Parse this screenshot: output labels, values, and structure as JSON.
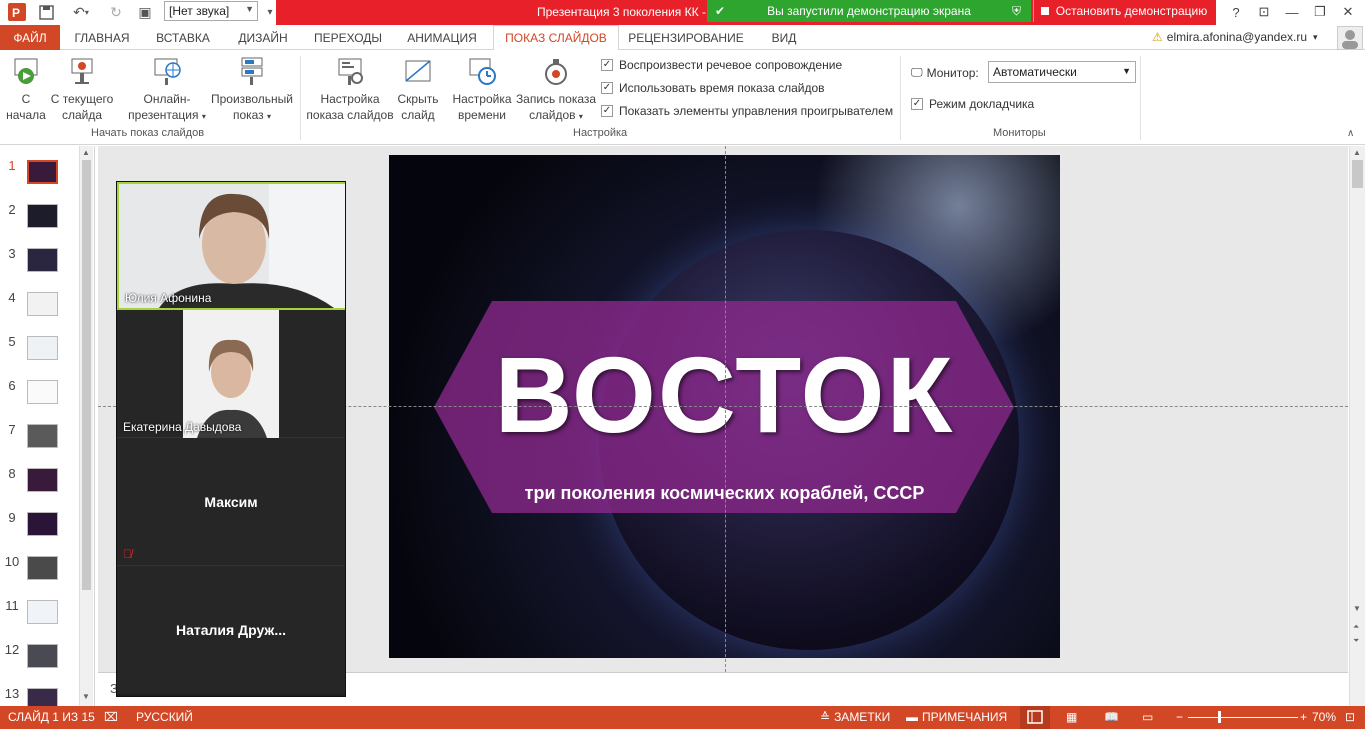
{
  "title_bar": {
    "sound_select_value": "[Нет звука]",
    "document_title": "Презентация 3 поколения КК -",
    "share_banner": "Вы запустили демонстрацию экрана",
    "stop_share_label": "Остановить демонстрацию",
    "help": "?"
  },
  "tabs": [
    {
      "label": "ФАЙЛ"
    },
    {
      "label": "ГЛАВНАЯ"
    },
    {
      "label": "ВСТАВКА"
    },
    {
      "label": "ДИЗАЙН"
    },
    {
      "label": "ПЕРЕХОДЫ"
    },
    {
      "label": "АНИМАЦИЯ"
    },
    {
      "label": "ПОКАЗ СЛАЙДОВ",
      "active": true
    },
    {
      "label": "РЕЦЕНЗИРОВАНИЕ"
    },
    {
      "label": "ВИД"
    }
  ],
  "account": {
    "email": "elmira.afonina@yandex.ru"
  },
  "ribbon": {
    "start_group": {
      "label": "Начать показ слайдов",
      "from_start": {
        "line1": "С",
        "line2": "начала"
      },
      "from_current": {
        "line1": "С текущего",
        "line2": "слайда"
      },
      "online": {
        "line1": "Онлайн-",
        "line2": "презентация"
      },
      "custom": {
        "line1": "Произвольный",
        "line2": "показ"
      }
    },
    "setup_group": {
      "label": "Настройка",
      "setup_show": {
        "line1": "Настройка",
        "line2": "показа слайдов"
      },
      "hide_slide": {
        "line1": "Скрыть",
        "line2": "слайд"
      },
      "rehearse": {
        "line1": "Настройка",
        "line2": "времени"
      },
      "record": {
        "line1": "Запись показа",
        "line2": "слайдов"
      },
      "checks": [
        "Воспроизвести речевое сопровождение",
        "Использовать время показа слайдов",
        "Показать элементы управления проигрывателем"
      ]
    },
    "monitors_group": {
      "label": "Мониторы",
      "monitor_label": "Монитор:",
      "monitor_value": "Автоматически",
      "presenter_view": "Режим докладчика"
    }
  },
  "thumbnails": [
    "1",
    "2",
    "3",
    "4",
    "5",
    "6",
    "7",
    "8",
    "9",
    "10",
    "11",
    "12",
    "13"
  ],
  "slide": {
    "title": "ВОСТОК",
    "subtitle": "три поколения космических кораблей, СССР"
  },
  "video_panel": {
    "participants": [
      {
        "name": "Юлия Афонина"
      },
      {
        "name": "Екатерина Давыдова"
      },
      {
        "name": "Максим"
      },
      {
        "name": "Наталия  Друж..."
      }
    ]
  },
  "notes_stub": "З",
  "status_bar": {
    "slide_info": "СЛАЙД 1 ИЗ 15",
    "language": "РУССКИЙ",
    "notes": "ЗАМЕТКИ",
    "comments": "ПРИМЕЧАНИЯ",
    "zoom": "70%"
  },
  "colors": {
    "accent": "#d24726",
    "share_green": "#2ea52e",
    "share_red": "#e8202a"
  }
}
